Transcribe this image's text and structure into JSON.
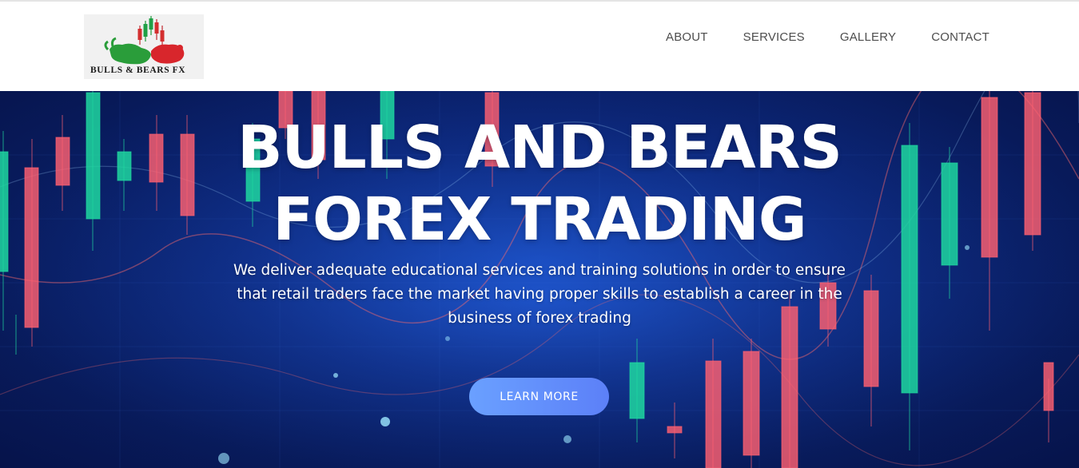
{
  "brand": {
    "logo_text": "BULLS & BEARS FX",
    "logo_icon": "bull-and-bear-candlestick-logo"
  },
  "nav": {
    "items": [
      {
        "label": "ABOUT"
      },
      {
        "label": "SERVICES"
      },
      {
        "label": "GALLERY"
      },
      {
        "label": "CONTACT"
      }
    ]
  },
  "hero": {
    "title_line1": "BULLS AND BEARS",
    "title_line2": "FOREX TRADING",
    "subtitle": "We deliver adequate educational services and training solutions in order to ensure that retail traders face the market having proper skills to establish a career in the business of forex trading",
    "cta_label": "LEARN MORE",
    "background": "candlestick-chart-image"
  },
  "colors": {
    "hero_bg": "#0d2a82",
    "candle_bull": "#1fd7a0",
    "candle_bear": "#ff6070",
    "cta_start": "#6aa0ff",
    "cta_end": "#5c80f8",
    "nav_text": "#4d4d4d"
  }
}
